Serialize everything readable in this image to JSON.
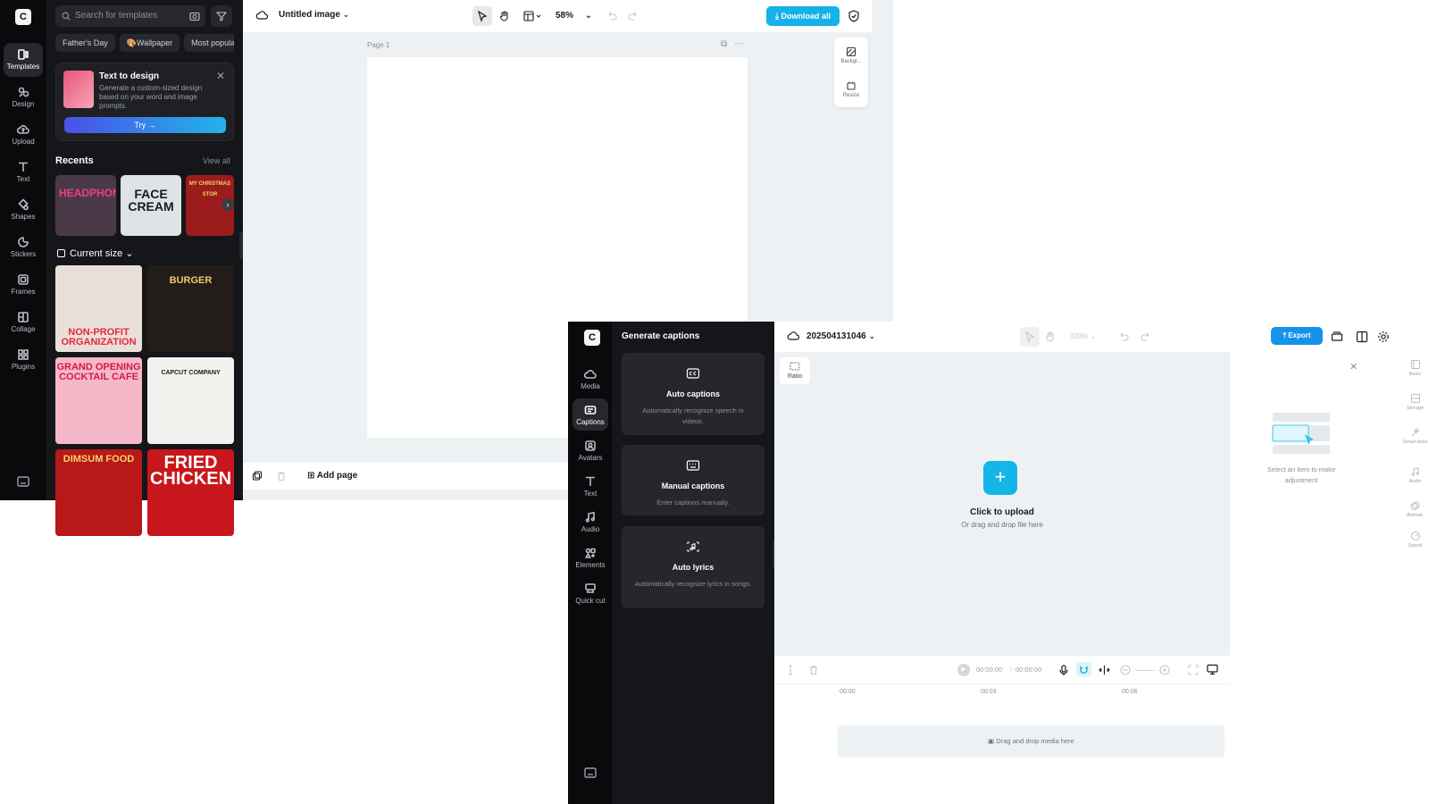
{
  "editor": {
    "rail": {
      "items": [
        {
          "label": "Templates",
          "icon": "templates-icon",
          "active": true
        },
        {
          "label": "Design",
          "icon": "design-icon"
        },
        {
          "label": "Upload",
          "icon": "upload-icon"
        },
        {
          "label": "Text",
          "icon": "text-icon"
        },
        {
          "label": "Shapes",
          "icon": "shapes-icon"
        },
        {
          "label": "Stickers",
          "icon": "stickers-icon"
        },
        {
          "label": "Frames",
          "icon": "frames-icon"
        },
        {
          "label": "Collage",
          "icon": "collage-icon"
        },
        {
          "label": "Plugins",
          "icon": "plugins-icon"
        }
      ]
    },
    "search": {
      "placeholder": "Search for templates"
    },
    "chips": [
      "Father's Day",
      "🎨Wallpaper",
      "Most popular"
    ],
    "text_to_design": {
      "title": "Text to design",
      "desc": "Generate a custom-sized design based on your word and image prompts.",
      "try_label": "Try →"
    },
    "recents": {
      "title": "Recents",
      "view_all": "View all",
      "items": [
        {
          "text": "HEADPHONE",
          "bg": "#4a3a48",
          "fg": "#f03a8c"
        },
        {
          "text": "FACE CREAM",
          "bg": "#dfe3e6",
          "fg": "#1a1a1a"
        },
        {
          "text": "MY CHRISTMAS STOR",
          "bg": "#9b1c1c",
          "fg": "#f6d36b"
        }
      ]
    },
    "current_size": "Current size",
    "templates": [
      {
        "text": "NON-PROFIT ORGANIZATION",
        "bg": "#e8e0d8",
        "fg": "#e8263a"
      },
      {
        "text": "BURGER",
        "bg": "#231d19",
        "fg": "#f0c86a"
      },
      {
        "text": "GRAND OPENING COCKTAIL CAFE",
        "bg": "#f6b8c8",
        "fg": "#d11a4a"
      },
      {
        "text": "CAPCUT COMPANY",
        "bg": "#f3f1ed",
        "fg": "#1a1a1a"
      },
      {
        "text": "DIMSUM FOOD",
        "bg": "#b81818",
        "fg": "#f6d36b"
      },
      {
        "text": "FRIED CHICKEN",
        "bg": "#c8171c",
        "fg": "#ffffff"
      }
    ],
    "topbar": {
      "doc_title": "Untitled image",
      "zoom": "58%",
      "download_label": "Download all"
    },
    "canvas": {
      "page_label": "Page 1",
      "side_tools": [
        "Backgr...",
        "Resize"
      ]
    },
    "bottom": {
      "add_page": "Add page"
    }
  },
  "video": {
    "rail": {
      "items": [
        {
          "label": "Media",
          "icon": "media-icon"
        },
        {
          "label": "Captions",
          "icon": "captions-icon",
          "active": true
        },
        {
          "label": "Avatars",
          "icon": "avatars-icon"
        },
        {
          "label": "Text",
          "icon": "text-icon"
        },
        {
          "label": "Audio",
          "icon": "audio-icon"
        },
        {
          "label": "Elements",
          "icon": "elements-icon"
        },
        {
          "label": "Quick cut",
          "icon": "quick-cut-icon"
        }
      ]
    },
    "panel": {
      "title": "Generate captions",
      "cards": [
        {
          "title": "Auto captions",
          "desc": "Automatically recognize speech in videos.",
          "icon": "cc-icon"
        },
        {
          "title": "Manual captions",
          "desc": "Enter captions manually.",
          "icon": "keyboard-icon"
        },
        {
          "title": "Auto lyrics",
          "desc": "Automatically recognize lyrics in songs.",
          "icon": "music-note-icon"
        }
      ]
    },
    "topbar": {
      "project_title": "202504131046",
      "zoom": "100%",
      "export_label": "Export"
    },
    "stage": {
      "ratio_label": "Ratio",
      "upload_title": "Click to upload",
      "upload_sub": "Or drag and drop file here"
    },
    "inspector": {
      "message": "Select an item to make adjustment",
      "tabs": [
        "Basic",
        "Storage",
        "Smart tools",
        "Audio",
        "Animat.",
        "Speed"
      ]
    },
    "timeline": {
      "time_current": "00:00:00",
      "time_total": "00:00:00",
      "ruler": [
        "00:00",
        "00:03",
        "00:06"
      ],
      "drop_label": "Drag and drop media here"
    }
  }
}
